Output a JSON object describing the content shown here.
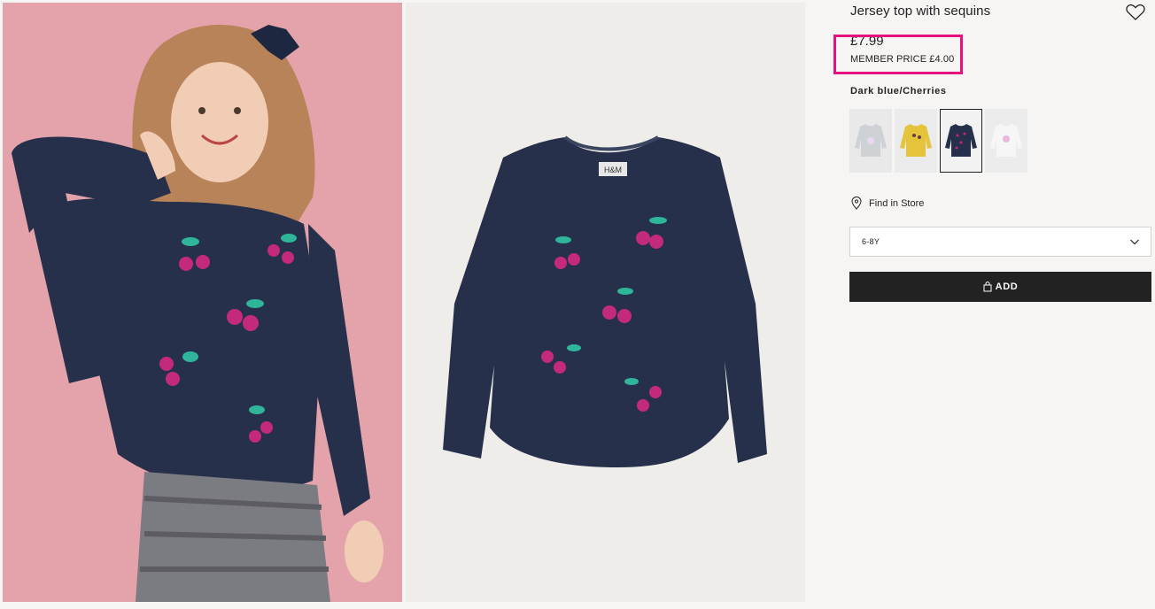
{
  "product": {
    "title": "Jersey top with sequins",
    "price": "£7.99",
    "member_price": "MEMBER PRICE £4.00",
    "color_name": "Dark blue/Cherries"
  },
  "swatches": [
    {
      "name": "grey-unicorn",
      "bg": "#e9e9e9",
      "shirt": "#cfd2d5"
    },
    {
      "name": "yellow",
      "bg": "#ebebeb",
      "shirt": "#e3c43b"
    },
    {
      "name": "dark-blue-cherries",
      "bg": "#f2f2f2",
      "shirt": "#26304a"
    },
    {
      "name": "white",
      "bg": "#ececec",
      "shirt": "#f4f4f4"
    }
  ],
  "actions": {
    "find_in_store": "Find in Store",
    "size_value": "6-8Y",
    "add_label": "ADD"
  },
  "images": {
    "model_label": "H&M"
  },
  "colors": {
    "accent_highlight": "#e6117f",
    "navy": "#26304a",
    "button_bg": "#222222"
  },
  "icons": {
    "favorite": "heart-icon",
    "store": "location-pin-icon",
    "dropdown": "chevron-down-icon",
    "bag": "shopping-bag-icon"
  }
}
